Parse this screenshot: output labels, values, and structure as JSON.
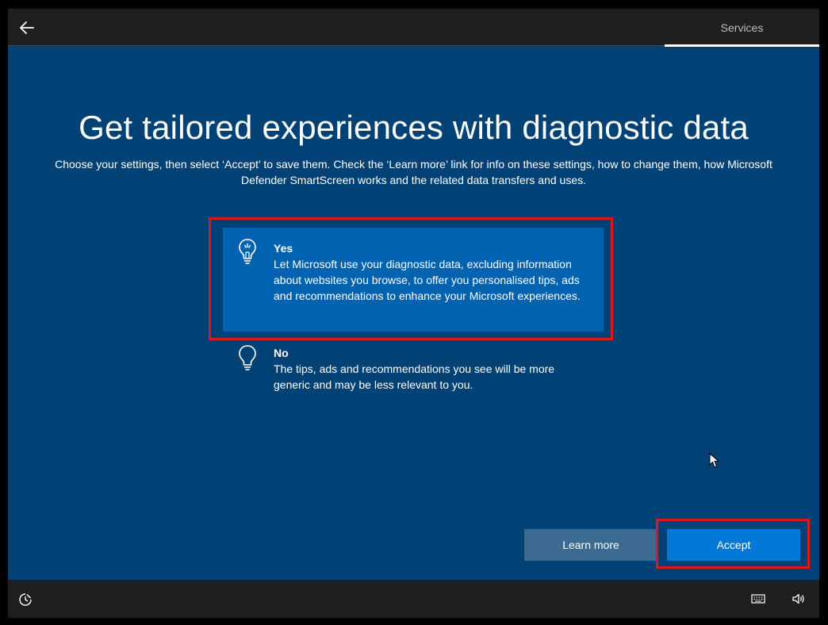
{
  "header": {
    "section_label": "Services"
  },
  "main": {
    "title": "Get tailored experiences with diagnostic data",
    "subtitle": "Choose your settings, then select ‘Accept’ to save them. Check the ‘Learn more’ link for info on these settings, how to change them, how Microsoft Defender SmartScreen works and the related data transfers and uses.",
    "options": [
      {
        "label": "Yes",
        "description": "Let Microsoft use your diagnostic data, excluding information about websites you browse, to offer you personalised tips, ads and recommendations to enhance your Microsoft experiences.",
        "selected": true
      },
      {
        "label": "No",
        "description": "The tips, ads and recommendations you see will be more generic and may be less relevant to you.",
        "selected": false
      }
    ]
  },
  "buttons": {
    "learn_more": "Learn more",
    "accept": "Accept"
  },
  "colors": {
    "background": "#004275",
    "selected_option": "#0063b1",
    "accept_button": "#0078d7",
    "learn_more_button": "#3d6a91",
    "highlight_box": "#e0131e",
    "bars": "#1f1f1f"
  },
  "icons": {
    "back": "back-arrow-icon",
    "option_yes": "lightbulb-lit-icon",
    "option_no": "lightbulb-icon",
    "ease_of_access": "ease-of-access-icon",
    "keyboard": "keyboard-icon",
    "volume": "volume-icon"
  }
}
